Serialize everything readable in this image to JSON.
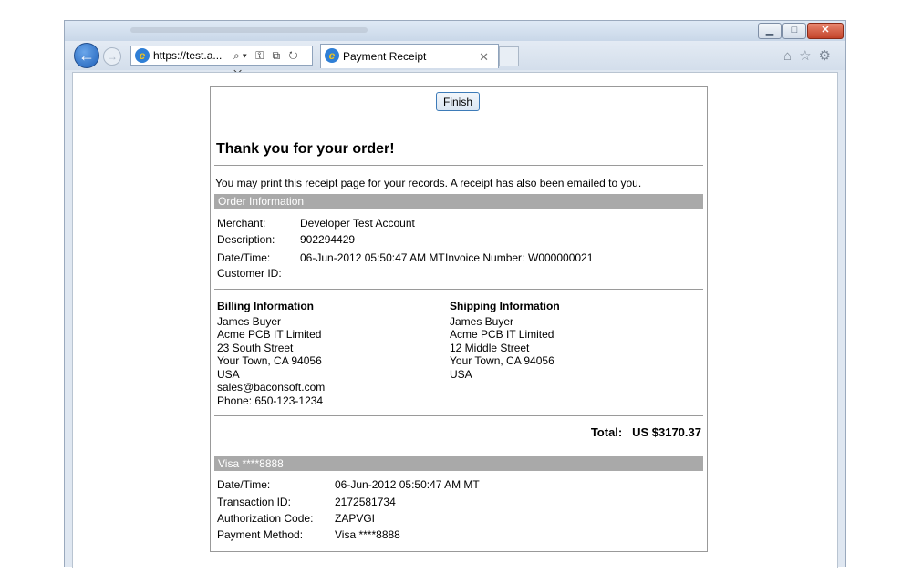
{
  "browser": {
    "address": "https://test.a...",
    "tab_title": "Payment Receipt"
  },
  "receipt": {
    "finish_label": "Finish",
    "heading": "Thank you for your order!",
    "note": "You may print this receipt page for your records. A receipt has also been emailed to you.",
    "order_header": "Order Information",
    "order": {
      "merchant_label": "Merchant:",
      "merchant_value": "Developer Test Account",
      "description_label": "Description:",
      "description_value": "902294429",
      "datetime_label": "Date/Time:",
      "datetime_value": "06-Jun-2012 05:50:47 AM MT",
      "invoice_label": "Invoice Number:",
      "invoice_value": "W000000021",
      "customer_label": "Customer ID:"
    },
    "billing": {
      "title": "Billing Information",
      "lines": [
        "James Buyer",
        "Acme PCB IT Limited",
        "23 South Street",
        "Your Town, CA 94056",
        "USA",
        "sales@baconsoft.com",
        "Phone: 650-123-1234"
      ]
    },
    "shipping": {
      "title": "Shipping Information",
      "lines": [
        "James Buyer",
        "Acme PCB IT Limited",
        "12 Middle Street",
        "Your Town, CA 94056",
        "USA"
      ]
    },
    "total_label": "Total:",
    "total_value": "US $3170.37",
    "payment_header": "Visa ****8888",
    "payment": {
      "datetime_label": "Date/Time:",
      "datetime_value": "06-Jun-2012 05:50:47 AM MT",
      "transaction_label": "Transaction ID:",
      "transaction_value": "2172581734",
      "auth_label": "Authorization Code:",
      "auth_value": "ZAPVGI",
      "method_label": "Payment Method:",
      "method_value": "Visa ****8888"
    }
  }
}
